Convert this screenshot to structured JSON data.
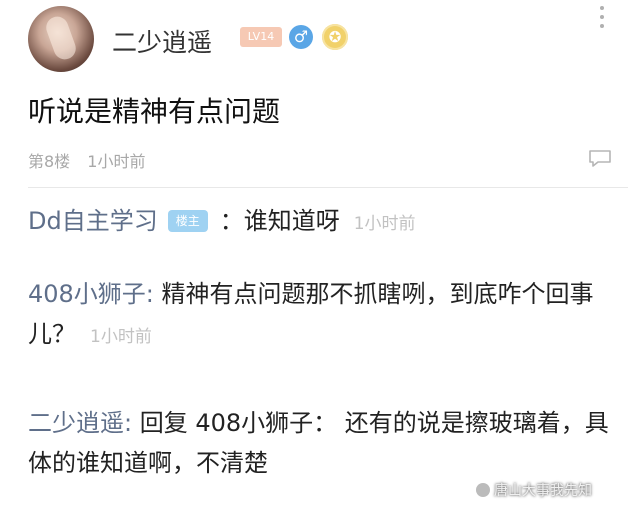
{
  "post": {
    "username": "二少逍遥",
    "level_badge": "LV14",
    "gender_symbol": "♂",
    "medal_symbol": "✪",
    "text": "听说是精神有点问题",
    "floor": "第8楼",
    "time": "1小时前"
  },
  "comments": [
    {
      "name": "Dd自主学习",
      "badge": "楼主",
      "content": "：谁知道呀",
      "time": "1小时前"
    },
    {
      "name": "408小狮子:",
      "content": " 精神有点问题那不抓瞎咧，到底咋个回事儿？",
      "time": "1小时前"
    },
    {
      "name": "二少逍遥:",
      "content": " 回复 408小狮子： 还有的说是擦玻璃着，具体的谁知道啊，不清楚",
      "time": ""
    }
  ],
  "watermark": "唐山大事我先知"
}
